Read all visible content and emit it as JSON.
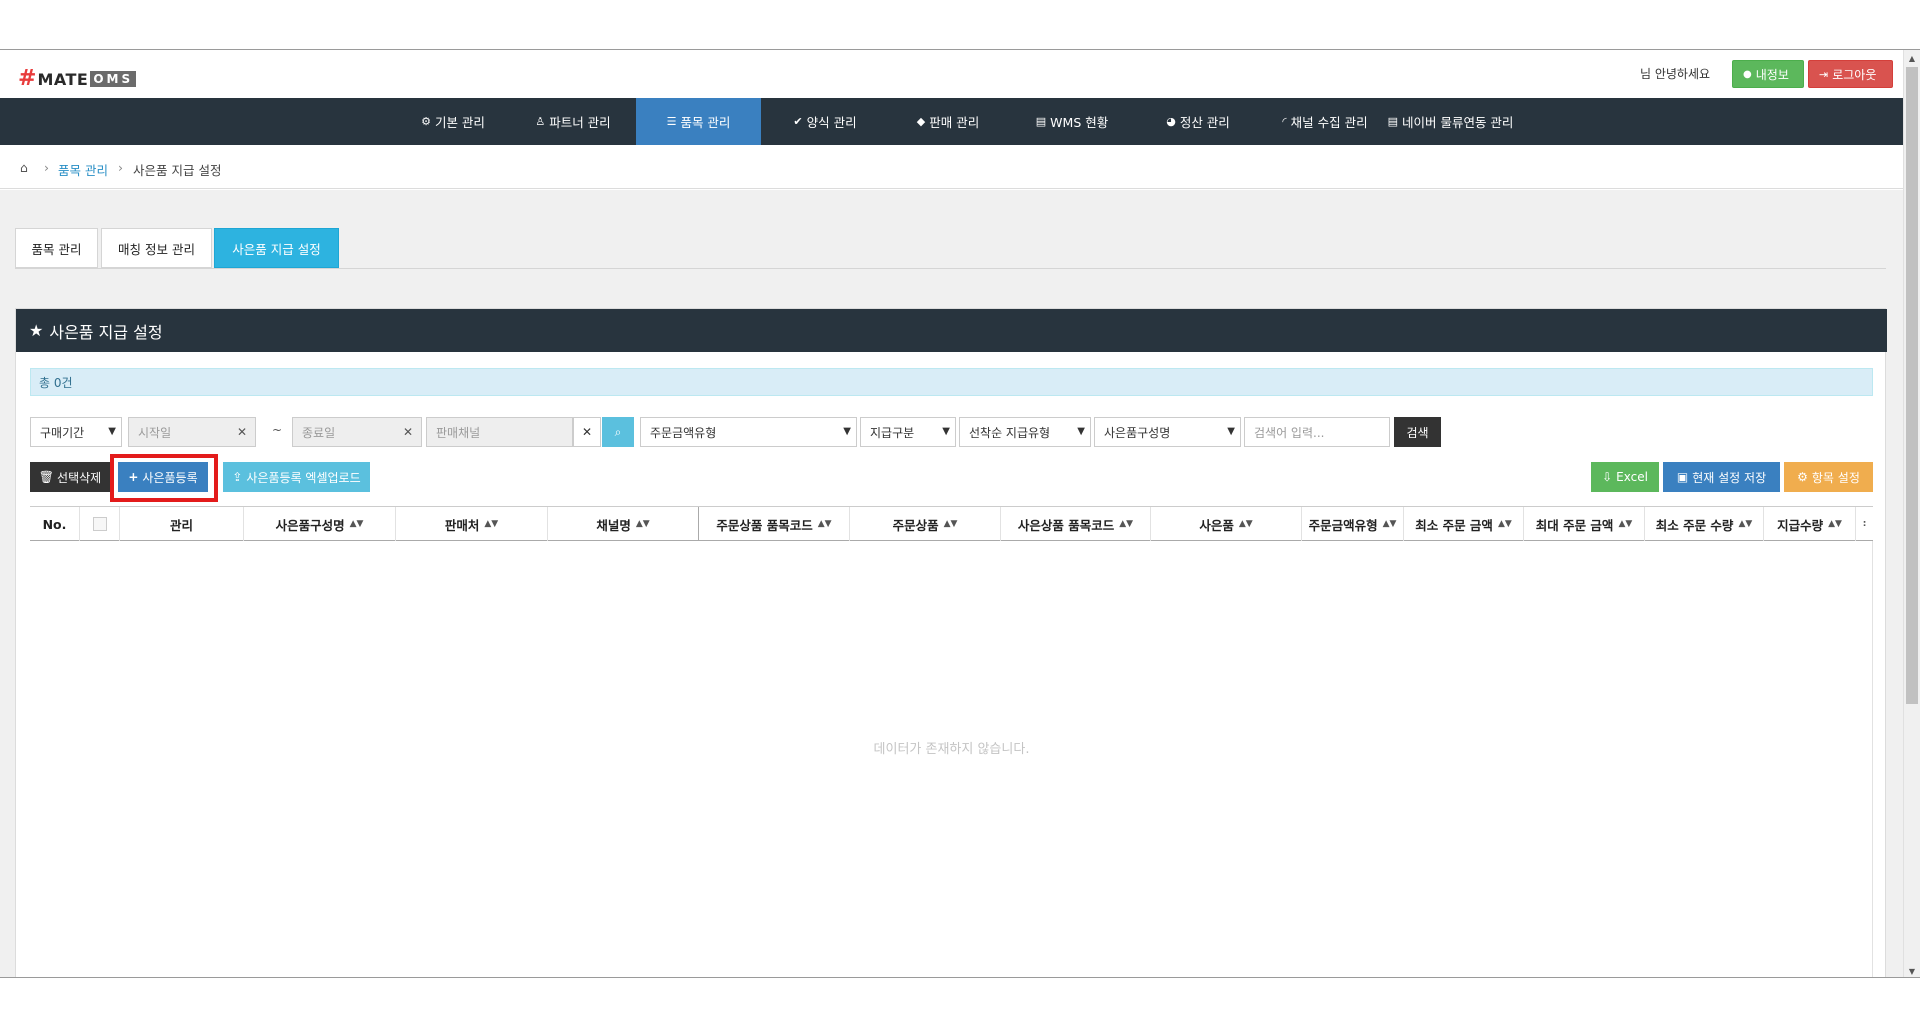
{
  "topbar": {
    "logo_hash": "#",
    "logo_mate": "MATE",
    "logo_oms": "OMS",
    "greeting": "님 안녕하세요",
    "myinfo_label": "내정보",
    "logout_label": "로그아웃",
    "colors": {
      "myinfo": "#5cb85c",
      "logout": "#d9534f"
    }
  },
  "nav": {
    "items": [
      {
        "label": "기본 관리",
        "icon": "gear-icon"
      },
      {
        "label": "파트너 관리",
        "icon": "user-icon"
      },
      {
        "label": "품목 관리",
        "icon": "list-icon",
        "active": true
      },
      {
        "label": "양식 관리",
        "icon": "check-icon"
      },
      {
        "label": "판매 관리",
        "icon": "diamond-icon"
      },
      {
        "label": "WMS 현황",
        "icon": "card-icon"
      },
      {
        "label": "정산 관리",
        "icon": "pie-chart-icon"
      },
      {
        "label": "채널 수집 관리",
        "icon": "rss-icon"
      },
      {
        "label": "네이버 물류연동 관리",
        "icon": "card-icon"
      }
    ],
    "colors": {
      "background": "#28343e",
      "active": "#3a80c0"
    }
  },
  "breadcrumb": {
    "home_icon": "home-icon",
    "separator": "›",
    "level1": "품목 관리",
    "level2": "사은품 지급 설정"
  },
  "tabs": [
    {
      "label": "품목 관리"
    },
    {
      "label": "매칭 정보 관리"
    },
    {
      "label": "사은품 지급 설정",
      "active": true
    }
  ],
  "panel": {
    "title": "사은품 지급 설정",
    "title_icon": "star-icon",
    "count_text": "총 0건"
  },
  "filters": {
    "period_select": "구매기간",
    "start_placeholder": "시작일",
    "tilde": "~",
    "end_placeholder": "종료일",
    "channel_placeholder": "판매채널",
    "amount_type_select": "주문금액유형",
    "pay_type_select": "지급구분",
    "first_come_select": "선착순 지급유형",
    "gift_name_select": "사은품구성명",
    "search_placeholder": "검색어 입력...",
    "search_label": "검색"
  },
  "actions": {
    "delete_label": "선택삭제",
    "register_label": "사은품등록",
    "excel_upload_label": "사은품등록 엑셀업로드",
    "excel_label": "Excel",
    "save_current_label": "현재 설정 저장",
    "item_settings_label": "항목 설정",
    "colors": {
      "dark": "#333333",
      "primary": "#3a80c0",
      "info": "#5bc0de",
      "success": "#5cb85c",
      "warning": "#f0ad4e",
      "highlight": "#e31b1b"
    }
  },
  "table": {
    "columns": [
      {
        "label": "No.",
        "sortable": false
      },
      {
        "label": "",
        "sortable": false
      },
      {
        "label": "관리",
        "sortable": false
      },
      {
        "label": "사은품구성명",
        "sortable": true
      },
      {
        "label": "판매처",
        "sortable": true
      },
      {
        "label": "채널명",
        "sortable": true
      },
      {
        "label": "주문상품 품목코드",
        "sortable": true
      },
      {
        "label": "주문상품",
        "sortable": true
      },
      {
        "label": "사은상품 품목코드",
        "sortable": true
      },
      {
        "label": "사은품",
        "sortable": true
      },
      {
        "label": "주문금액유형",
        "sortable": true
      },
      {
        "label": "최소 주문 금액",
        "sortable": true
      },
      {
        "label": "최대 주문 금액",
        "sortable": true
      },
      {
        "label": "최소 주문 수량",
        "sortable": true
      },
      {
        "label": "지급수량",
        "sortable": true
      }
    ],
    "rows": [],
    "empty_message": "데이터가 존재하지 않습니다."
  }
}
